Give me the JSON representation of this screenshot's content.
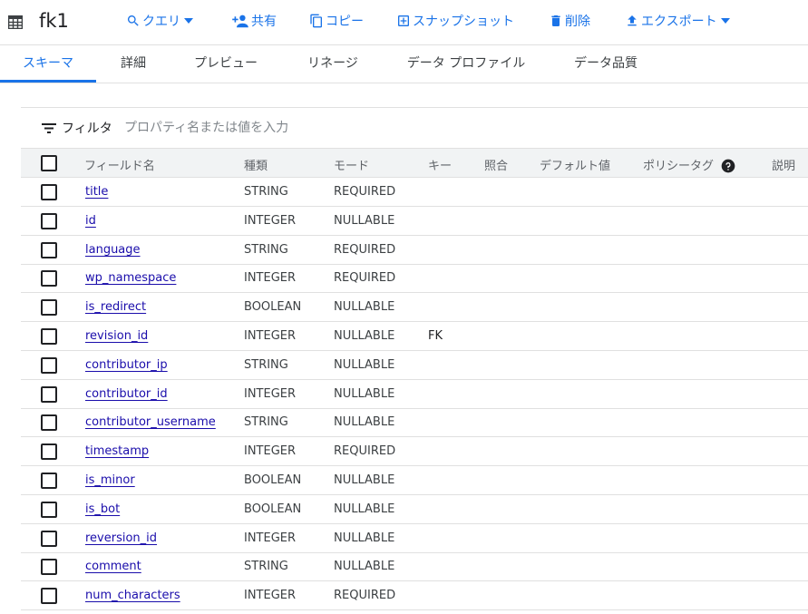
{
  "header": {
    "title": "fk1",
    "buttons": {
      "query": "クエリ",
      "share": "共有",
      "copy": "コピー",
      "snapshot": "スナップショット",
      "delete": "削除",
      "export": "エクスポート"
    }
  },
  "tabs": [
    "スキーマ",
    "詳細",
    "プレビュー",
    "リネージ",
    "データ プロファイル",
    "データ品質"
  ],
  "filter": {
    "label": "フィルタ",
    "placeholder": "プロパティ名または値を入力"
  },
  "columns": {
    "name": "フィールド名",
    "type": "種類",
    "mode": "モード",
    "key": "キー",
    "collation": "照合",
    "default": "デフォルト値",
    "policy": "ポリシータグ",
    "description": "説明"
  },
  "rows": [
    {
      "name": "title",
      "type": "STRING",
      "mode": "REQUIRED",
      "key": ""
    },
    {
      "name": "id",
      "type": "INTEGER",
      "mode": "NULLABLE",
      "key": ""
    },
    {
      "name": "language",
      "type": "STRING",
      "mode": "REQUIRED",
      "key": ""
    },
    {
      "name": "wp_namespace",
      "type": "INTEGER",
      "mode": "REQUIRED",
      "key": ""
    },
    {
      "name": "is_redirect",
      "type": "BOOLEAN",
      "mode": "NULLABLE",
      "key": ""
    },
    {
      "name": "revision_id",
      "type": "INTEGER",
      "mode": "NULLABLE",
      "key": "FK"
    },
    {
      "name": "contributor_ip",
      "type": "STRING",
      "mode": "NULLABLE",
      "key": ""
    },
    {
      "name": "contributor_id",
      "type": "INTEGER",
      "mode": "NULLABLE",
      "key": ""
    },
    {
      "name": "contributor_username",
      "type": "STRING",
      "mode": "NULLABLE",
      "key": ""
    },
    {
      "name": "timestamp",
      "type": "INTEGER",
      "mode": "REQUIRED",
      "key": ""
    },
    {
      "name": "is_minor",
      "type": "BOOLEAN",
      "mode": "NULLABLE",
      "key": ""
    },
    {
      "name": "is_bot",
      "type": "BOOLEAN",
      "mode": "NULLABLE",
      "key": ""
    },
    {
      "name": "reversion_id",
      "type": "INTEGER",
      "mode": "NULLABLE",
      "key": ""
    },
    {
      "name": "comment",
      "type": "STRING",
      "mode": "NULLABLE",
      "key": ""
    },
    {
      "name": "num_characters",
      "type": "INTEGER",
      "mode": "REQUIRED",
      "key": ""
    }
  ],
  "colors": {
    "accent": "#1a73e8",
    "link": "#1a0dab",
    "header_bg": "#f1f3f4",
    "divider": "#e0e0e0"
  },
  "icons": {
    "table": "table-grid-icon",
    "query": "search-icon",
    "share": "person-add-icon",
    "copy": "copy-icon",
    "snapshot": "add-box-icon",
    "delete": "trash-icon",
    "export": "upload-icon",
    "filter": "filter-lines-icon",
    "help": "help-circle-icon"
  }
}
